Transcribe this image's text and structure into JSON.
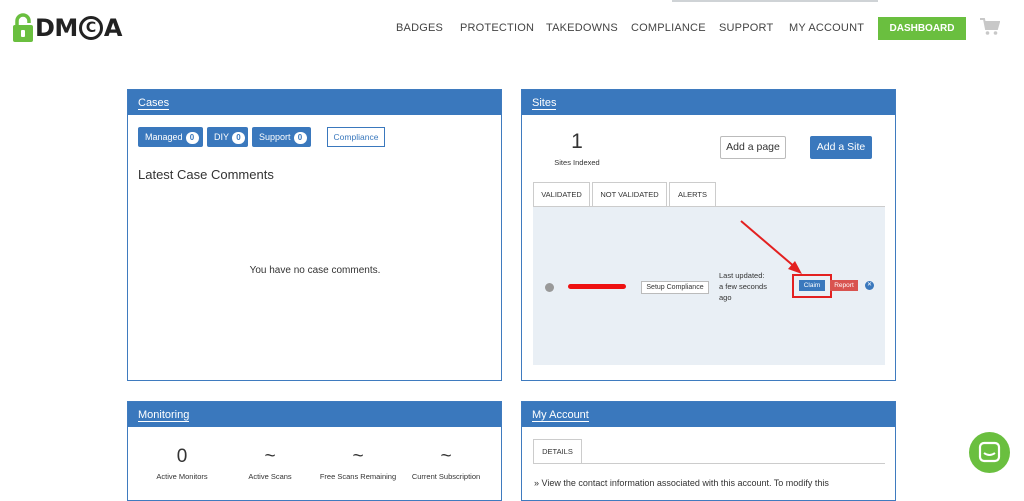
{
  "header": {
    "logo_text_d": "D",
    "logo_text_m": "M",
    "logo_text_c": "C",
    "logo_text_a": "A",
    "nav": [
      "BADGES",
      "PROTECTION",
      "TAKEDOWNS",
      "COMPLIANCE",
      "SUPPORT",
      "MY ACCOUNT"
    ],
    "dashboard_label": "DASHBOARD"
  },
  "cases": {
    "title": "Cases",
    "buttons": [
      {
        "label": "Managed",
        "count": "0"
      },
      {
        "label": "DIY",
        "count": "0"
      },
      {
        "label": "Support",
        "count": "0"
      }
    ],
    "compliance_label": "Compliance",
    "comments_heading": "Latest Case Comments",
    "empty_text": "You have no case comments."
  },
  "sites": {
    "title": "Sites",
    "count": "1",
    "count_label": "Sites Indexed",
    "add_page_label": "Add a page",
    "add_site_label": "Add a Site",
    "tabs": [
      "VALIDATED",
      "NOT VALIDATED",
      "ALERTS"
    ],
    "row": {
      "setup_label": "Setup Compliance",
      "last_updated_line1": "Last updated:",
      "last_updated_line2": "a few seconds",
      "last_updated_line3": "ago",
      "claim_label": "Claim",
      "report_label": "Report",
      "remove_glyph": "✕"
    }
  },
  "monitoring": {
    "title": "Monitoring",
    "stats": [
      {
        "value": "0",
        "label": "Active Monitors"
      },
      {
        "value": "~",
        "label": "Active Scans"
      },
      {
        "value": "~",
        "label": "Free Scans Remaining"
      },
      {
        "value": "~",
        "label": "Current Subscription"
      }
    ]
  },
  "account": {
    "title": "My Account",
    "tab_label": "DETAILS",
    "text": "» View the contact information associated with this account. To modify this"
  },
  "colors": {
    "primary": "#3a78bd",
    "green": "#6abf3f",
    "danger": "#d9534f",
    "annotation_red": "#e32020"
  }
}
